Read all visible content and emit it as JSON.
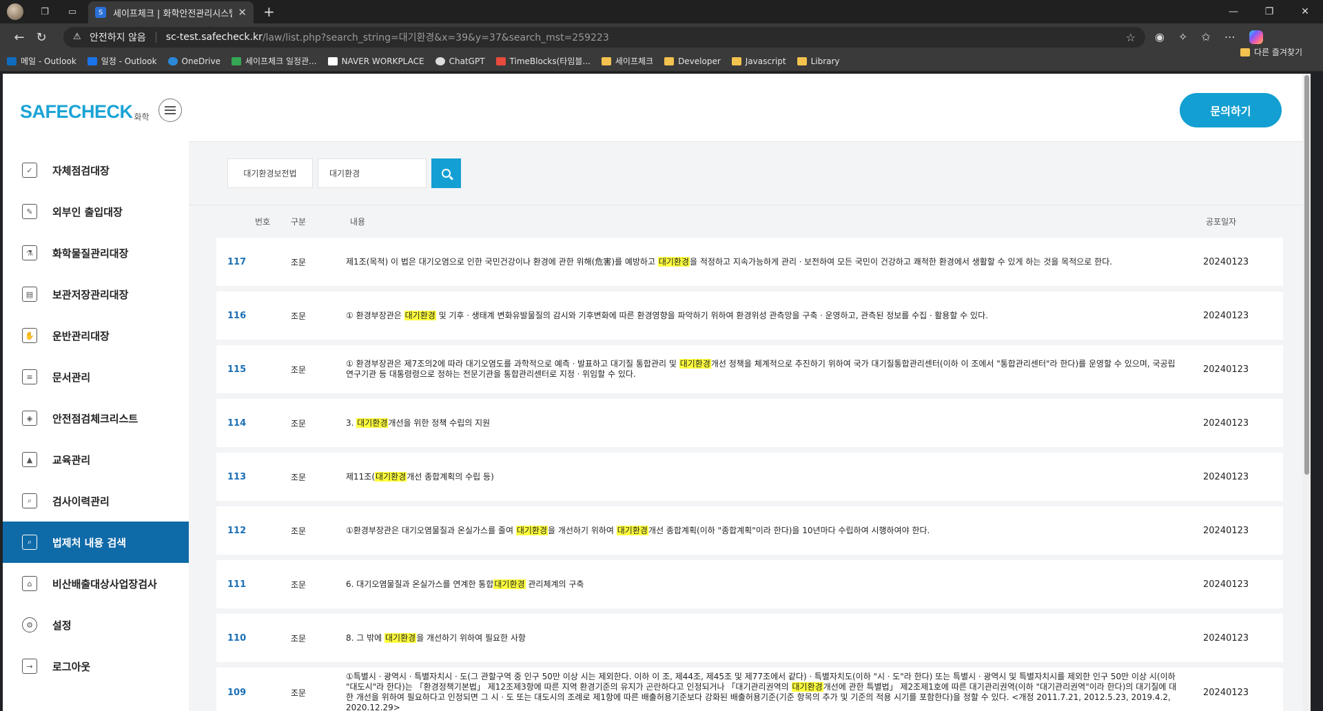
{
  "browser": {
    "tab_title": "세이프체크 | 화학안전관리시스템",
    "security_label": "안전하지 않음",
    "url_host": "sc-test.safecheck.kr",
    "url_path": "/law/list.php?search_string=대기환경&x=39&y=37&search_mst=259223",
    "bookmarks": [
      "메일 - Outlook",
      "일정 - Outlook",
      "OneDrive",
      "세이프체크 일정관...",
      "NAVER WORKPLACE",
      "ChatGPT",
      "TimeBlocks(타임블...",
      "세이프체크",
      "Developer",
      "Javascript",
      "Library"
    ],
    "other_bookmarks": "다른 즐겨찾기"
  },
  "sidebar": {
    "logo": "SAFECHECK",
    "logo_sub": "화학",
    "items": [
      {
        "label": "자체점검대장",
        "icon": "clipboard-check-icon"
      },
      {
        "label": "외부인 출입대장",
        "icon": "edit-note-icon"
      },
      {
        "label": "화학물질관리대장",
        "icon": "flask-icon"
      },
      {
        "label": "보관저장관리대장",
        "icon": "archive-box-icon"
      },
      {
        "label": "운반관리대장",
        "icon": "hand-carry-icon"
      },
      {
        "label": "문서관리",
        "icon": "document-icon"
      },
      {
        "label": "안전점검체크리스트",
        "icon": "shield-check-icon"
      },
      {
        "label": "교육관리",
        "icon": "graduation-cap-icon"
      },
      {
        "label": "검사이력관리",
        "icon": "file-search-icon"
      },
      {
        "label": "법제처 내용 검색",
        "icon": "law-search-icon"
      },
      {
        "label": "비산배출대상사업장검사",
        "icon": "factory-icon"
      },
      {
        "label": "설정",
        "icon": "gear-icon"
      },
      {
        "label": "로그아웃",
        "icon": "logout-icon"
      }
    ]
  },
  "header": {
    "inquiry_button": "문의하기"
  },
  "search": {
    "law_select": "대기환경보전법",
    "query": "대기환경"
  },
  "table": {
    "headers": {
      "no": "번호",
      "type": "구분",
      "body": "내용",
      "date": "공포일자"
    },
    "highlight": "대기환경",
    "rows": [
      {
        "no": "117",
        "type": "조문",
        "date": "20240123",
        "body": "제1조(목적) 이 법은 대기오염으로 인한 국민건강이나 환경에 관한 위해(危害)를 예방하고 대기환경을 적정하고 지속가능하게 관리ㆍ보전하여 모든 국민이 건강하고 쾌적한 환경에서 생활할 수 있게 하는 것을 목적으로 한다."
      },
      {
        "no": "116",
        "type": "조문",
        "date": "20240123",
        "body": "① 환경부장관은 대기환경 및 기후ㆍ생태계 변화유발물질의 감시와 기후변화에 따른 환경영향을 파악하기 위하여 환경위성 관측망을 구축ㆍ운영하고, 관측된 정보를 수집ㆍ활용할 수 있다."
      },
      {
        "no": "115",
        "type": "조문",
        "date": "20240123",
        "body": "① 환경부장관은 제7조의2에 따라 대기오염도를 과학적으로 예측ㆍ발표하고 대기질 통합관리 및 대기환경개선 정책을 체계적으로 추진하기 위하여 국가 대기질통합관리센터(이하 이 조에서 \"통합관리센터\"라 한다)를 운영할 수 있으며, 국공립 연구기관 등 대통령령으로 정하는 전문기관을 통합관리센터로 지정ㆍ위임할 수 있다."
      },
      {
        "no": "114",
        "type": "조문",
        "date": "20240123",
        "body": "3. 대기환경개선을 위한 정책 수립의 지원"
      },
      {
        "no": "113",
        "type": "조문",
        "date": "20240123",
        "body": "제11조(대기환경개선 종합계획의 수립 등)"
      },
      {
        "no": "112",
        "type": "조문",
        "date": "20240123",
        "body": "①환경부장관은 대기오염물질과 온실가스를 줄여 대기환경을 개선하기 위하여 대기환경개선 종합계획(이하 \"종합계획\"이라 한다)을 10년마다 수립하여 시행하여야 한다."
      },
      {
        "no": "111",
        "type": "조문",
        "date": "20240123",
        "body": "6. 대기오염물질과 온실가스를 연계한 통합대기환경 관리체계의 구축"
      },
      {
        "no": "110",
        "type": "조문",
        "date": "20240123",
        "body": "8. 그 밖에 대기환경을 개선하기 위하여 필요한 사항"
      },
      {
        "no": "109",
        "type": "조문",
        "date": "20240123",
        "body": "①특별시ㆍ광역시ㆍ특별자치시ㆍ도(그 관할구역 중 인구 50만 이상 시는 제외한다. 이하 이 조, 제44조, 제45조 및 제77조에서 같다)ㆍ특별자치도(이하 \"시ㆍ도\"라 한다) 또는 특별시ㆍ광역시 및 특별자치시를 제외한 인구 50만 이상 시(이하 \"대도시\"라 한다)는 「환경정책기본법」 제12조제3항에 따른 지역 환경기준의 유지가 곤란하다고 인정되거나 「대기관리권역의 대기환경개선에 관한 특별법」 제2조제1호에 따른 대기관리권역(이하 \"대기관리권역\"이라 한다)의 대기질에 대한 개선을 위하여 필요하다고 인정되면 그 시ㆍ도 또는 대도시의 조례로 제1항에 따른 배출허용기준보다 강화된 배출허용기준(기준 항목의 추가 및 기준의 적용 시기를 포함한다)을 정할 수 있다. <개정 2011.7.21, 2012.5.23, 2019.4.2, 2020.12.29>"
      }
    ]
  }
}
